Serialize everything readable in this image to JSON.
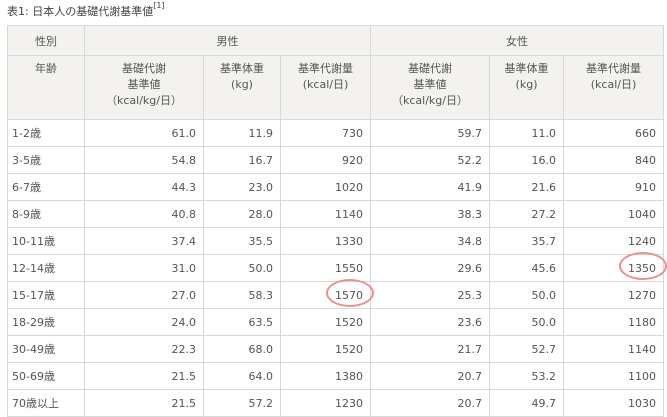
{
  "caption": {
    "text": "表1: 日本人の基礎代謝基準値",
    "ref": "[1]"
  },
  "header": {
    "col0_top": "性別",
    "col0_bottom": "年齢",
    "male": "男性",
    "female": "女性",
    "sub": [
      {
        "l1": "基礎代謝",
        "l2": "基準値",
        "l3": "（kcal/kg/日）"
      },
      {
        "l1": "基準体重",
        "l2": "(kg)"
      },
      {
        "l1": "基準代謝量",
        "l2": "(kcal/日)"
      },
      {
        "l1": "基礎代謝",
        "l2": "基準値",
        "l3": "（kcal/kg/日）"
      },
      {
        "l1": "基準体重",
        "l2": "(kg)"
      },
      {
        "l1": "基準代謝量",
        "l2": "(kcal/日)"
      }
    ]
  },
  "rows": [
    [
      "1-2歳",
      "61.0",
      "11.9",
      "730",
      "59.7",
      "11.0",
      "660"
    ],
    [
      "3-5歳",
      "54.8",
      "16.7",
      "920",
      "52.2",
      "16.0",
      "840"
    ],
    [
      "6-7歳",
      "44.3",
      "23.0",
      "1020",
      "41.9",
      "21.6",
      "910"
    ],
    [
      "8-9歳",
      "40.8",
      "28.0",
      "1140",
      "38.3",
      "27.2",
      "1040"
    ],
    [
      "10-11歳",
      "37.4",
      "35.5",
      "1330",
      "34.8",
      "35.7",
      "1240"
    ],
    [
      "12-14歳",
      "31.0",
      "50.0",
      "1550",
      "29.6",
      "45.6",
      "1350"
    ],
    [
      "15-17歳",
      "27.0",
      "58.3",
      "1570",
      "25.3",
      "50.0",
      "1270"
    ],
    [
      "18-29歳",
      "24.0",
      "63.5",
      "1520",
      "23.6",
      "50.0",
      "1180"
    ],
    [
      "30-49歳",
      "22.3",
      "68.0",
      "1520",
      "21.7",
      "52.7",
      "1140"
    ],
    [
      "50-69歳",
      "21.5",
      "64.0",
      "1380",
      "20.7",
      "53.2",
      "1100"
    ],
    [
      "70歳以上",
      "21.5",
      "57.2",
      "1230",
      "20.7",
      "49.7",
      "1030"
    ]
  ],
  "highlights": [
    {
      "row": 6,
      "col": 3
    },
    {
      "row": 5,
      "col": 6
    }
  ],
  "colors": {
    "header_bg": "#f4f2ee",
    "border": "#d8d8d8",
    "highlight_circle": "#ec8f8f",
    "text": "#555555"
  }
}
